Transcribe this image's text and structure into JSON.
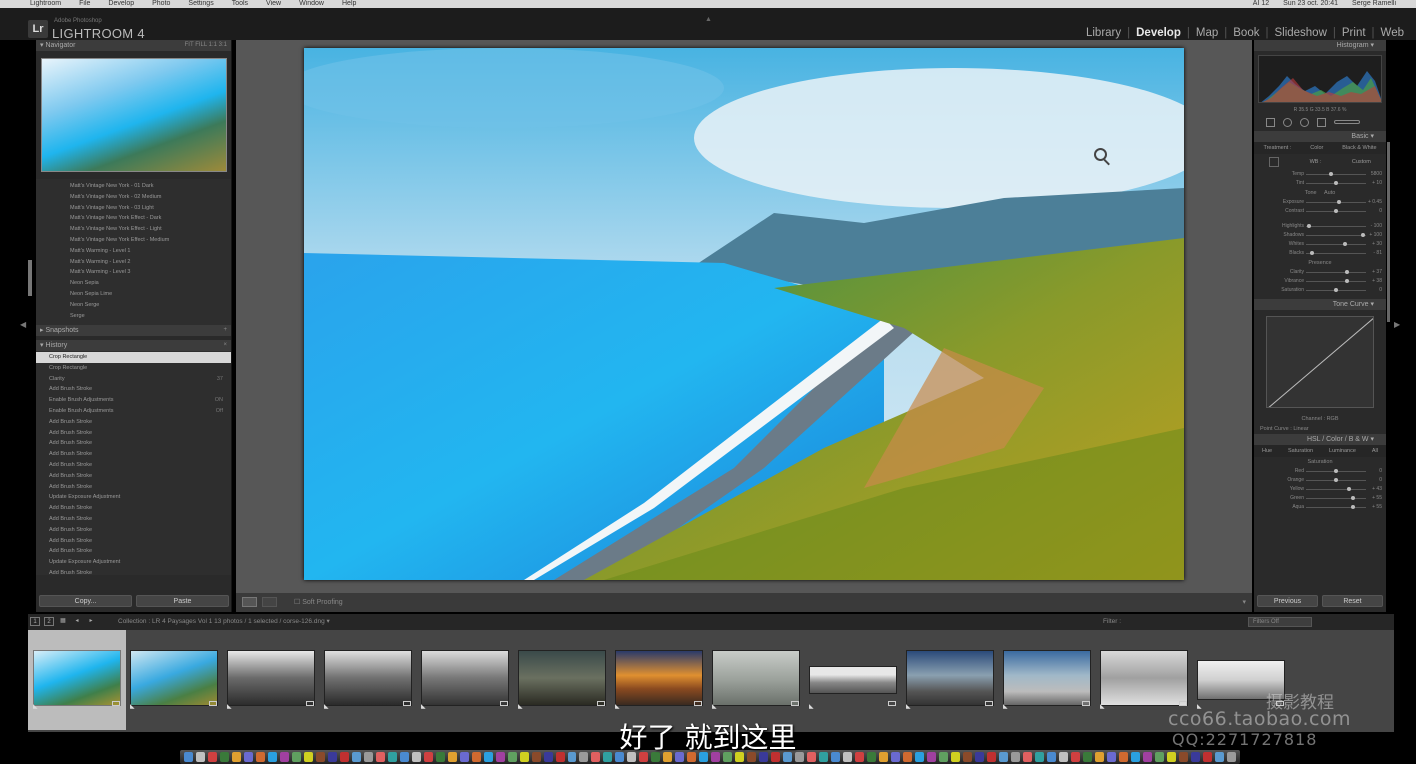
{
  "menubar": {
    "items": [
      "Lightroom",
      "File",
      "Develop",
      "Photo",
      "Settings",
      "Tools",
      "View",
      "Window",
      "Help"
    ],
    "right": [
      "AI 12",
      "Sun 23 oct. 20:41",
      "Serge Ramelli"
    ]
  },
  "identity": {
    "badge": "Lr",
    "small_text": "Adobe Photoshop",
    "title": "LIGHTROOM 4"
  },
  "modules": [
    "Library",
    "Develop",
    "Map",
    "Book",
    "Slideshow",
    "Print",
    "Web"
  ],
  "active_module": "Develop",
  "left": {
    "navigator_title": "Navigator",
    "navigator_zoom": "FIT  FILL  1:1  3:1",
    "presets": [
      "Matt's Vintage New York - 01 Dark",
      "Matt's Vintage New York - 02 Medium",
      "Matt's Vintage New York - 03 Light",
      "Matt's Vintage New York Effect - Dark",
      "Matt's Vintage New York Effect - Light",
      "Matt's Vintage New York Effect - Medium",
      "Matt's Warming - Level 1",
      "Matt's Warming - Level 2",
      "Matt's Warming - Level 3",
      "Neon Sepia",
      "Neon Sepia Lime",
      "Neon Serge",
      "Serge"
    ],
    "snapshots_title": "Snapshots",
    "history_title": "History",
    "history": [
      {
        "label": "Crop Rectangle",
        "count": ""
      },
      {
        "label": "Crop Rectangle",
        "count": ""
      },
      {
        "label": "Clarity",
        "count": "37"
      },
      {
        "label": "Add Brush Stroke",
        "count": ""
      },
      {
        "label": "Enable Brush Adjustments",
        "count": "ON"
      },
      {
        "label": "Enable Brush Adjustments",
        "count": "Off"
      },
      {
        "label": "Add Brush Stroke",
        "count": ""
      },
      {
        "label": "Add Brush Stroke",
        "count": ""
      },
      {
        "label": "Add Brush Stroke",
        "count": ""
      },
      {
        "label": "Add Brush Stroke",
        "count": ""
      },
      {
        "label": "Add Brush Stroke",
        "count": ""
      },
      {
        "label": "Add Brush Stroke",
        "count": ""
      },
      {
        "label": "Add Brush Stroke",
        "count": ""
      },
      {
        "label": "Update Exposure Adjustment",
        "count": ""
      },
      {
        "label": "Add Brush Stroke",
        "count": ""
      },
      {
        "label": "Add Brush Stroke",
        "count": ""
      },
      {
        "label": "Add Brush Stroke",
        "count": ""
      },
      {
        "label": "Add Brush Stroke",
        "count": ""
      },
      {
        "label": "Add Brush Stroke",
        "count": ""
      },
      {
        "label": "Update Exposure Adjustment",
        "count": ""
      },
      {
        "label": "Add Brush Stroke",
        "count": ""
      }
    ],
    "copy_label": "Copy...",
    "paste_label": "Paste"
  },
  "toolbar": {
    "soft_proofing": "Soft Proofing"
  },
  "right": {
    "histogram_title": "Histogram",
    "histogram_caption": "R  35.5  G  33.5  B  37.6 %",
    "basic_title": "Basic",
    "treatment": {
      "label": "Treatment :",
      "color": "Color",
      "bw": "Black & White"
    },
    "wb": {
      "label": "WB :",
      "value": "Custom"
    },
    "sliders_wb": [
      {
        "label": "Temp",
        "value": "5800",
        "pos": 0.42
      },
      {
        "label": "Tint",
        "value": "+ 10",
        "pos": 0.5
      }
    ],
    "tone_label": "Tone",
    "tone_auto": "Auto",
    "sliders_tone": [
      {
        "label": "Exposure",
        "value": "+ 0.45",
        "pos": 0.55
      },
      {
        "label": "Contrast",
        "value": "0",
        "pos": 0.5
      }
    ],
    "sliders_tone2": [
      {
        "label": "Highlights",
        "value": "- 100",
        "pos": 0.05
      },
      {
        "label": "Shadows",
        "value": "+ 100",
        "pos": 0.95
      },
      {
        "label": "Whites",
        "value": "+ 30",
        "pos": 0.65
      },
      {
        "label": "Blacks",
        "value": "- 81",
        "pos": 0.1
      }
    ],
    "presence_label": "Presence",
    "sliders_presence": [
      {
        "label": "Clarity",
        "value": "+ 37",
        "pos": 0.68
      },
      {
        "label": "Vibrance",
        "value": "+ 38",
        "pos": 0.69
      },
      {
        "label": "Saturation",
        "value": "0",
        "pos": 0.5
      }
    ],
    "tonecurve_title": "Tone Curve",
    "channel": "Channel : RGB",
    "point_curve": "Point Curve : Linear",
    "hsl_title": "HSL / Color / B & W",
    "hsl_tabs": [
      "Hue",
      "Saturation",
      "Luminance",
      "All"
    ],
    "saturation_label": "Saturation",
    "sliders_sat": [
      {
        "label": "Red",
        "value": "0",
        "pos": 0.5
      },
      {
        "label": "Orange",
        "value": "0",
        "pos": 0.5
      },
      {
        "label": "Yellow",
        "value": "+ 43",
        "pos": 0.72
      },
      {
        "label": "Green",
        "value": "+ 55",
        "pos": 0.78
      },
      {
        "label": "Aqua",
        "value": "+ 55",
        "pos": 0.78
      }
    ],
    "previous_label": "Previous",
    "reset_label": "Reset"
  },
  "filmstrip_bar": {
    "page1": "1",
    "page2": "2",
    "path": "Collection : LR 4 Paysages Vol 1    13 photos / 1 selected / corse-126.dng ▾",
    "filter_label": "Filter :",
    "filter_value": "Filters Off"
  },
  "filmstrip": {
    "count": 13,
    "selected_index": 0
  },
  "subtitle": "好了 就到这里",
  "watermark": {
    "line1": "摄影教程",
    "line2": "cco66.taobao.com",
    "line3": "QQ:2271727818"
  },
  "colors": {
    "accent": "#e8e8e8",
    "panel": "#2a2a2a",
    "selected_history": "#d8d8d8"
  }
}
